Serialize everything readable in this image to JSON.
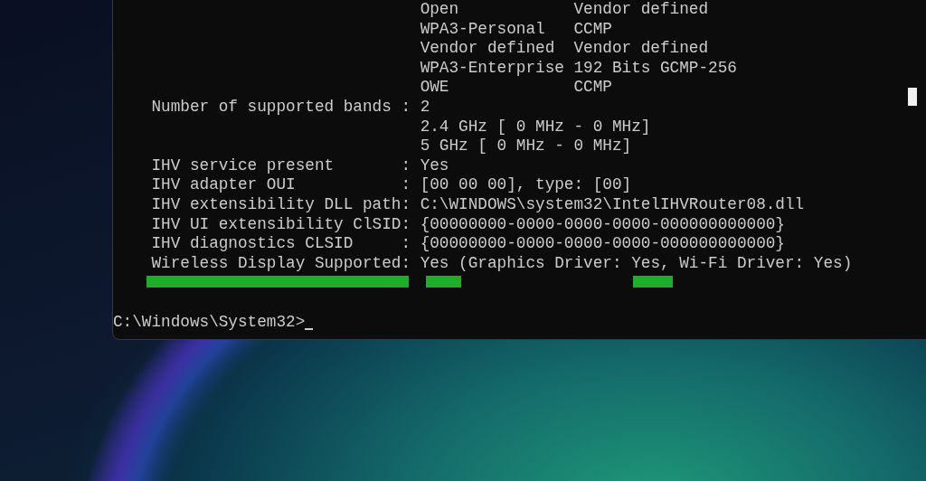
{
  "terminal": {
    "lines": [
      {
        "kind": "pair",
        "col_1": "Open",
        "col_2": "Vendor defined"
      },
      {
        "kind": "pair",
        "col_1": "WPA3-Personal",
        "col_2": "CCMP"
      },
      {
        "kind": "pair",
        "col_1": "Vendor defined",
        "col_2": "Vendor defined"
      },
      {
        "kind": "pair",
        "col_1": "WPA3-Enterprise",
        "col_2": "192 Bits GCMP-256"
      },
      {
        "kind": "pair",
        "col_1": "OWE",
        "col_2": "CCMP"
      },
      {
        "kind": "field",
        "label": "Number of supported bands :",
        "value": "2"
      },
      {
        "kind": "continuation",
        "value": "2.4 GHz [ 0 MHz - 0 MHz]"
      },
      {
        "kind": "continuation",
        "value": "5 GHz [ 0 MHz - 0 MHz]"
      },
      {
        "kind": "field",
        "label": "IHV service present       :",
        "value": "Yes"
      },
      {
        "kind": "field",
        "label": "IHV adapter OUI           :",
        "value": "[00 00 00], type: [00]"
      },
      {
        "kind": "field",
        "label": "IHV extensibility DLL path:",
        "value": "C:\\WINDOWS\\system32\\IntelIHVRouter08.dll"
      },
      {
        "kind": "field",
        "label": "IHV UI extensibility ClSID:",
        "value": "{00000000-0000-0000-0000-000000000000}"
      },
      {
        "kind": "field",
        "label": "IHV diagnostics CLSID     :",
        "value": "{00000000-0000-0000-0000-000000000000}"
      },
      {
        "kind": "field",
        "label": "Wireless Display Supported:",
        "value": "Yes (Graphics Driver: Yes, Wi-Fi Driver: Yes)"
      }
    ],
    "prompt": "C:\\Windows\\System32>"
  }
}
